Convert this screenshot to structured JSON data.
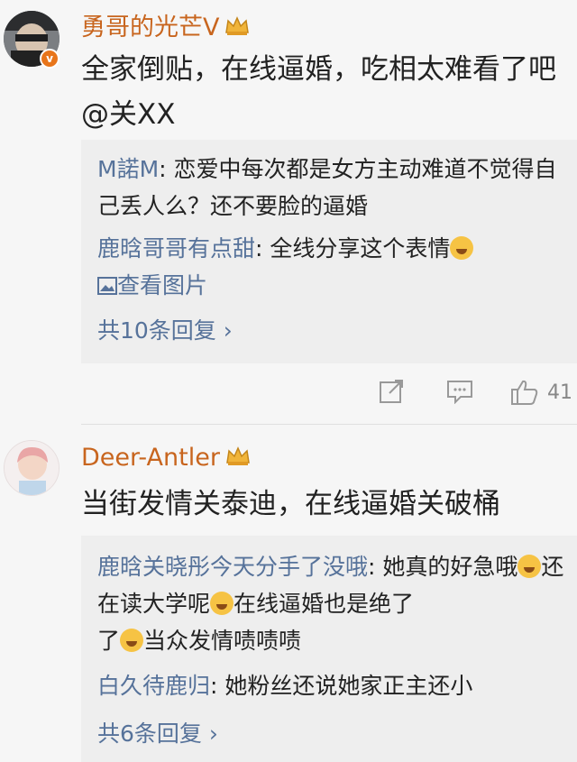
{
  "comments": [
    {
      "username": "勇哥的光芒V",
      "text": "全家倒贴，在线逼婚，吃相太难看了吧@关XX",
      "replies": [
        {
          "user": "M諾M",
          "sep": ": ",
          "text": "恋爱中每次都是女方主动难道不觉得自己丢人么？还不要脸的逼婚"
        },
        {
          "user": "鹿晗哥哥有点甜",
          "sep": ": ",
          "text": "全线分享这个表情",
          "view_image": "查看图片"
        }
      ],
      "more": "共10条回复 ›",
      "like_count": "41"
    },
    {
      "username": "Deer-Antler",
      "text": "当街发情关泰迪，在线逼婚关破桶",
      "replies": [
        {
          "user": "鹿晗关晓彤今天分手了没哦",
          "sep": ": ",
          "text_a": "她真的好急哦",
          "text_b": "还在读大学呢",
          "text_c": "在线逼婚也是绝了",
          "text_d": "当众发情啧啧啧"
        },
        {
          "user": "白久待鹿归",
          "sep": ": ",
          "text": "她粉丝还说她家正主还小"
        }
      ],
      "more": "共6条回复 ›"
    }
  ],
  "colors": {
    "username": "#c8651e",
    "link": "#56729a",
    "background": "#f6f6f6",
    "reply_bg": "#eeeeee"
  },
  "icons": [
    "crown-icon",
    "verified-badge-icon",
    "share-icon",
    "comment-icon",
    "like-icon",
    "smiley-emoji-icon",
    "laugh-emoji-icon"
  ]
}
